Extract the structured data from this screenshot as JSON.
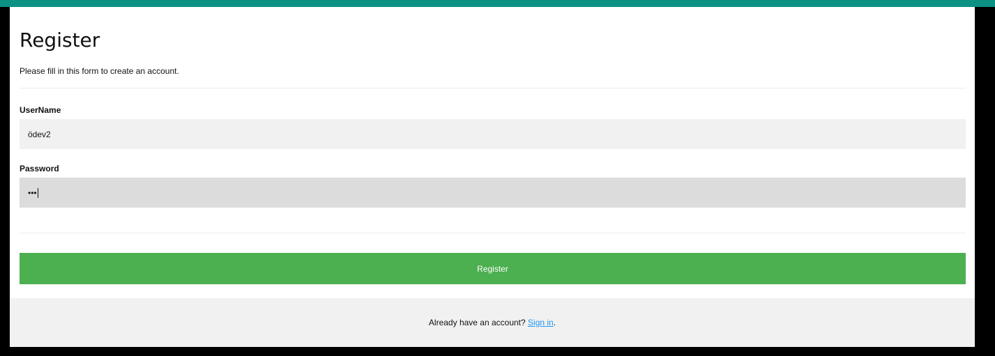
{
  "colors": {
    "top_bar": "#0b9283",
    "register_button": "#4caf50",
    "link": "#2196f3",
    "input_background": "#f1f1f1",
    "input_focused_background": "#dcdcdc"
  },
  "form": {
    "title": "Register",
    "subtitle": "Please fill in this form to create an account.",
    "username": {
      "label": "UserName",
      "value": "ödev2"
    },
    "password": {
      "label": "Password",
      "masked_value": "•••"
    },
    "submit_label": "Register"
  },
  "footer": {
    "text": "Already have an account? ",
    "link_label": "Sign in",
    "trailing": "."
  }
}
